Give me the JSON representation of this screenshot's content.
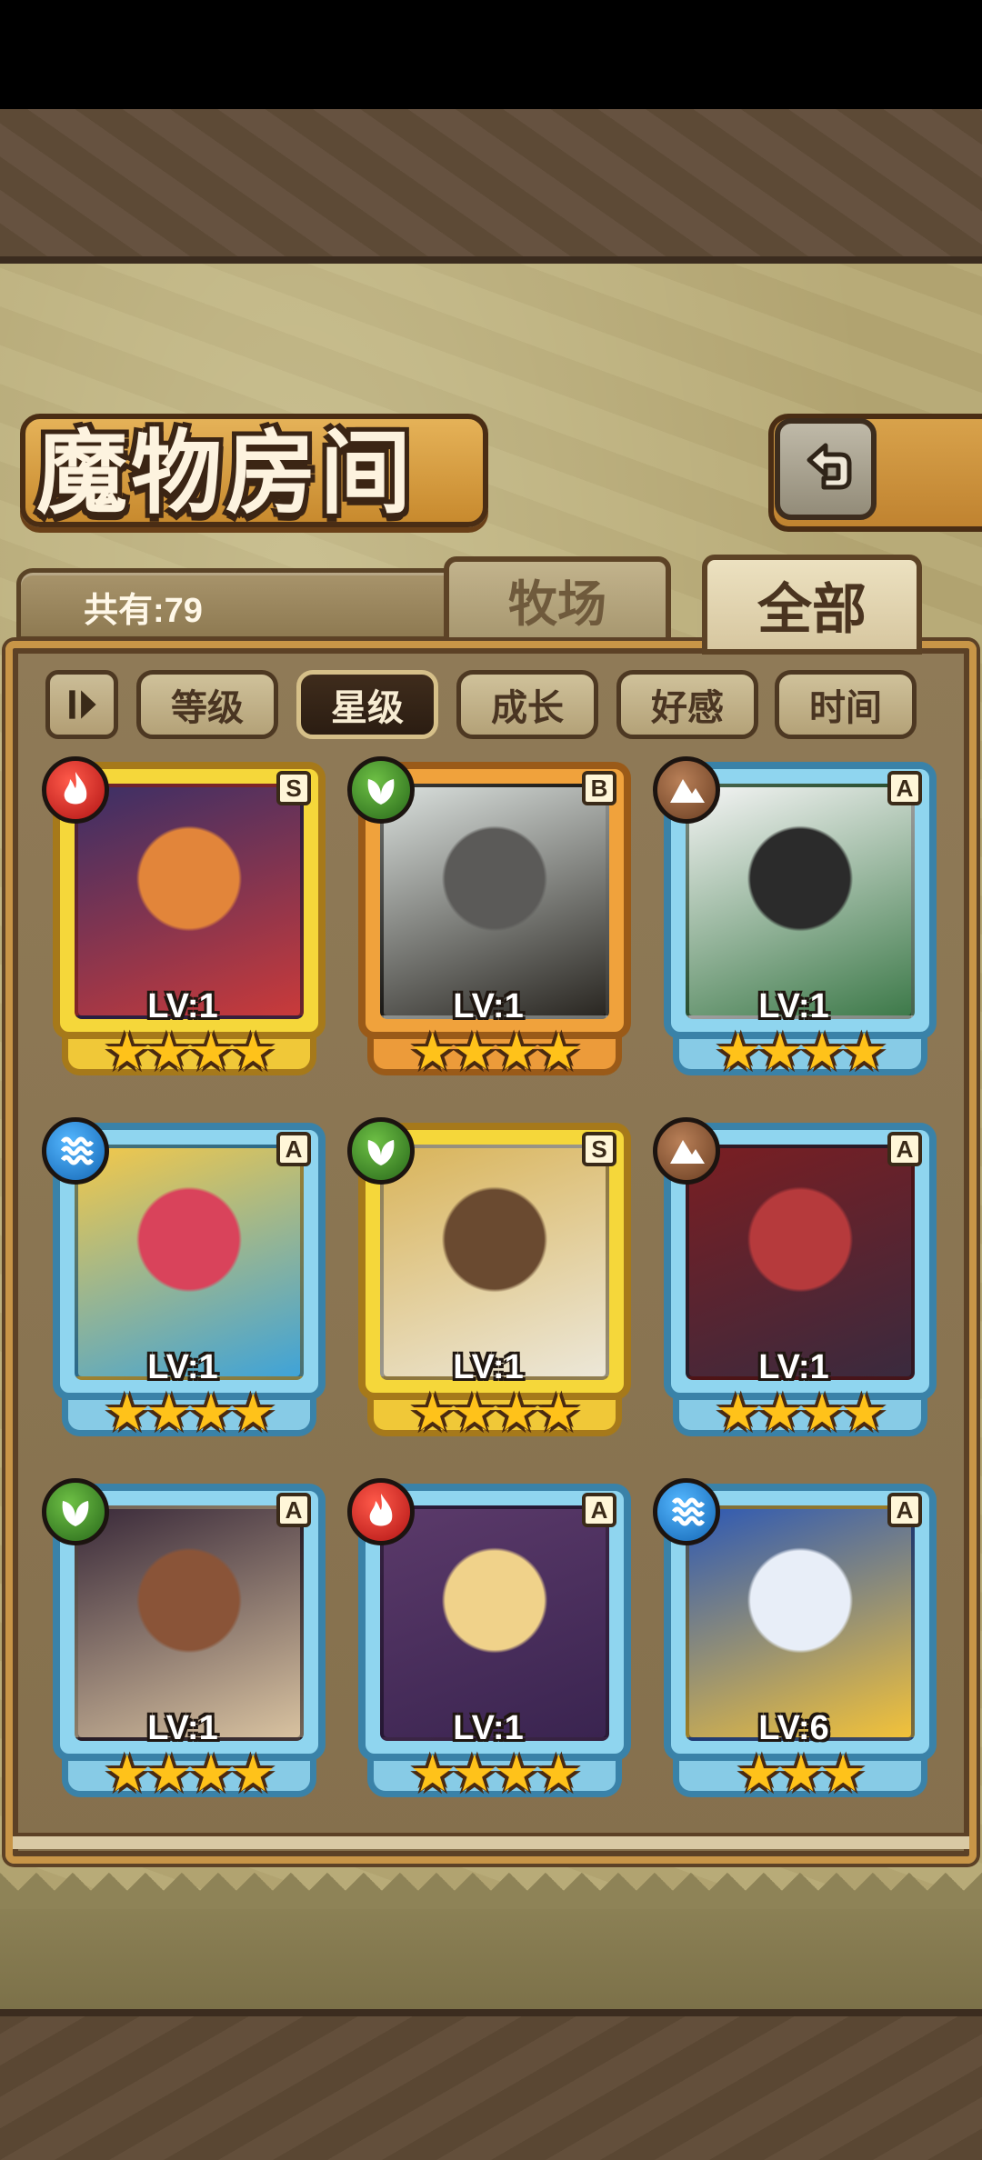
{
  "header": {
    "title": "魔物房间"
  },
  "summary": {
    "count_label": "共有:79"
  },
  "tabs": [
    {
      "label": "牧场"
    },
    {
      "label": "全部"
    }
  ],
  "sort": {
    "buttons": [
      "等级",
      "星级",
      "成长",
      "好感",
      "时间"
    ],
    "active": "星级"
  },
  "cards": [
    {
      "element": "fire",
      "rank": "S",
      "level": "LV:1",
      "stars": "★★★★",
      "frame": "gold",
      "art": [
        "#3b2f66",
        "#e2853a",
        "#c93a3a"
      ]
    },
    {
      "element": "leaf",
      "rank": "B",
      "level": "LV:1",
      "stars": "★★★★",
      "frame": "orange",
      "art": [
        "#d9dfdc",
        "#5b5a58",
        "#2a2722"
      ]
    },
    {
      "element": "earth",
      "rank": "A",
      "level": "LV:1",
      "stars": "★★★★",
      "frame": "blue",
      "art": [
        "#f4f4f4",
        "#2b2b2b",
        "#3e7a4a"
      ]
    },
    {
      "element": "water",
      "rank": "A",
      "level": "LV:1",
      "stars": "★★★★",
      "frame": "blue",
      "art": [
        "#f3c84a",
        "#d9435b",
        "#3fa3d8"
      ]
    },
    {
      "element": "leaf",
      "rank": "S",
      "level": "LV:1",
      "stars": "★★★★",
      "frame": "gold",
      "art": [
        "#d9b45a",
        "#6a4a30",
        "#ece7d8"
      ]
    },
    {
      "element": "earth",
      "rank": "A",
      "level": "LV:1",
      "stars": "★★★★",
      "frame": "blue",
      "art": [
        "#7a1e22",
        "#b63a3c",
        "#3a2a3e"
      ]
    },
    {
      "element": "leaf",
      "rank": "A",
      "level": "LV:1",
      "stars": "★★★★",
      "frame": "blue",
      "art": [
        "#3a2a3a",
        "#8a5438",
        "#d8c2a0"
      ]
    },
    {
      "element": "fire",
      "rank": "A",
      "level": "LV:1",
      "stars": "★★★★",
      "frame": "blue",
      "art": [
        "#5b3a6a",
        "#f0d28a",
        "#3a2450"
      ]
    },
    {
      "element": "water",
      "rank": "A",
      "level": "LV:6",
      "stars": "★★★",
      "frame": "blue",
      "art": [
        "#2e59b4",
        "#e8eef8",
        "#f2c23a"
      ]
    }
  ]
}
